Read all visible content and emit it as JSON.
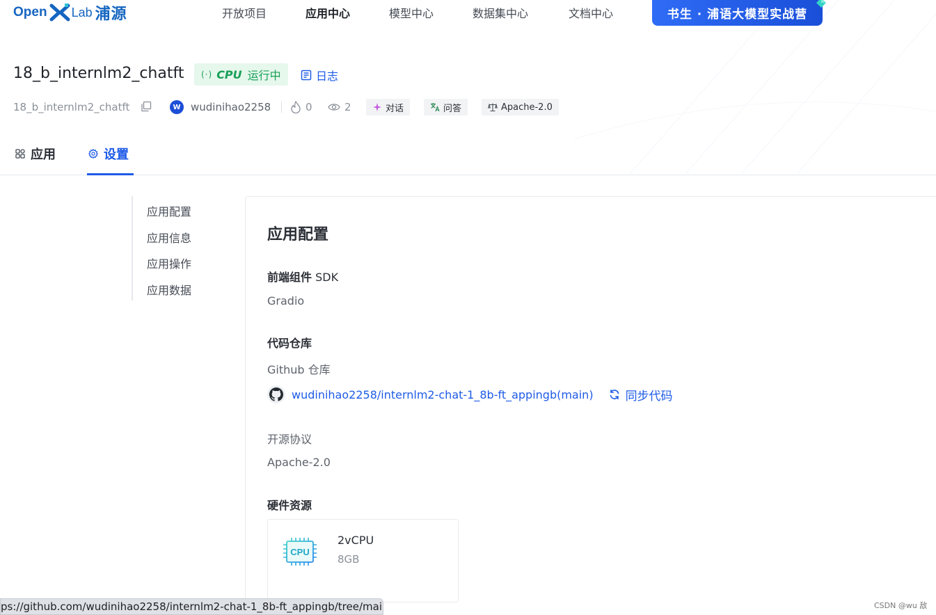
{
  "brand": {
    "open": "Open",
    "lab": "Lab",
    "cn": "浦源"
  },
  "nav": {
    "items": [
      "开放项目",
      "应用中心",
      "模型中心",
      "数据集中心",
      "文档中心"
    ],
    "active_index": 1,
    "promo": "书生 · 浦语大模型实战营"
  },
  "app": {
    "title": "18_b_internlm2_chatft",
    "status_pulse": "(·)",
    "status_hw": "CPU",
    "status_text": "运行中",
    "log_label": "日志",
    "repo_name": "18_b_internlm2_chatft",
    "avatar_letter": "W",
    "owner": "wudinihao2258",
    "likes": "0",
    "views": "2",
    "tags": [
      "对话",
      "问答",
      "Apache-2.0"
    ]
  },
  "tabs": [
    "应用",
    "设置"
  ],
  "sidemenu": [
    "应用配置",
    "应用信息",
    "应用操作",
    "应用数据"
  ],
  "config": {
    "title": "应用配置",
    "sdk_label_bold": "前端组件",
    "sdk_label_plain": " SDK",
    "sdk_value": "Gradio",
    "repo_label": "代码仓库",
    "repo_type": "Github 仓库",
    "repo_link": "wudinihao2258/internlm2-chat-1_8b-ft_appingb(main)",
    "sync_label": "同步代码",
    "license_label": "开源协议",
    "license_value": "Apache-2.0",
    "hw_label": "硬件资源",
    "hw_chip_text": "CPU",
    "hw_cores": "2vCPU",
    "hw_memory": "8GB"
  },
  "statusbar_url": "ps://github.com/wudinihao2258/internlm2-chat-1_8b-ft_appingb/tree/main",
  "watermark": "CSDN @wu 敌",
  "colors": {
    "accent": "#1e5be6",
    "running_bg": "#e6f7ec",
    "running_fg": "#18a058"
  }
}
